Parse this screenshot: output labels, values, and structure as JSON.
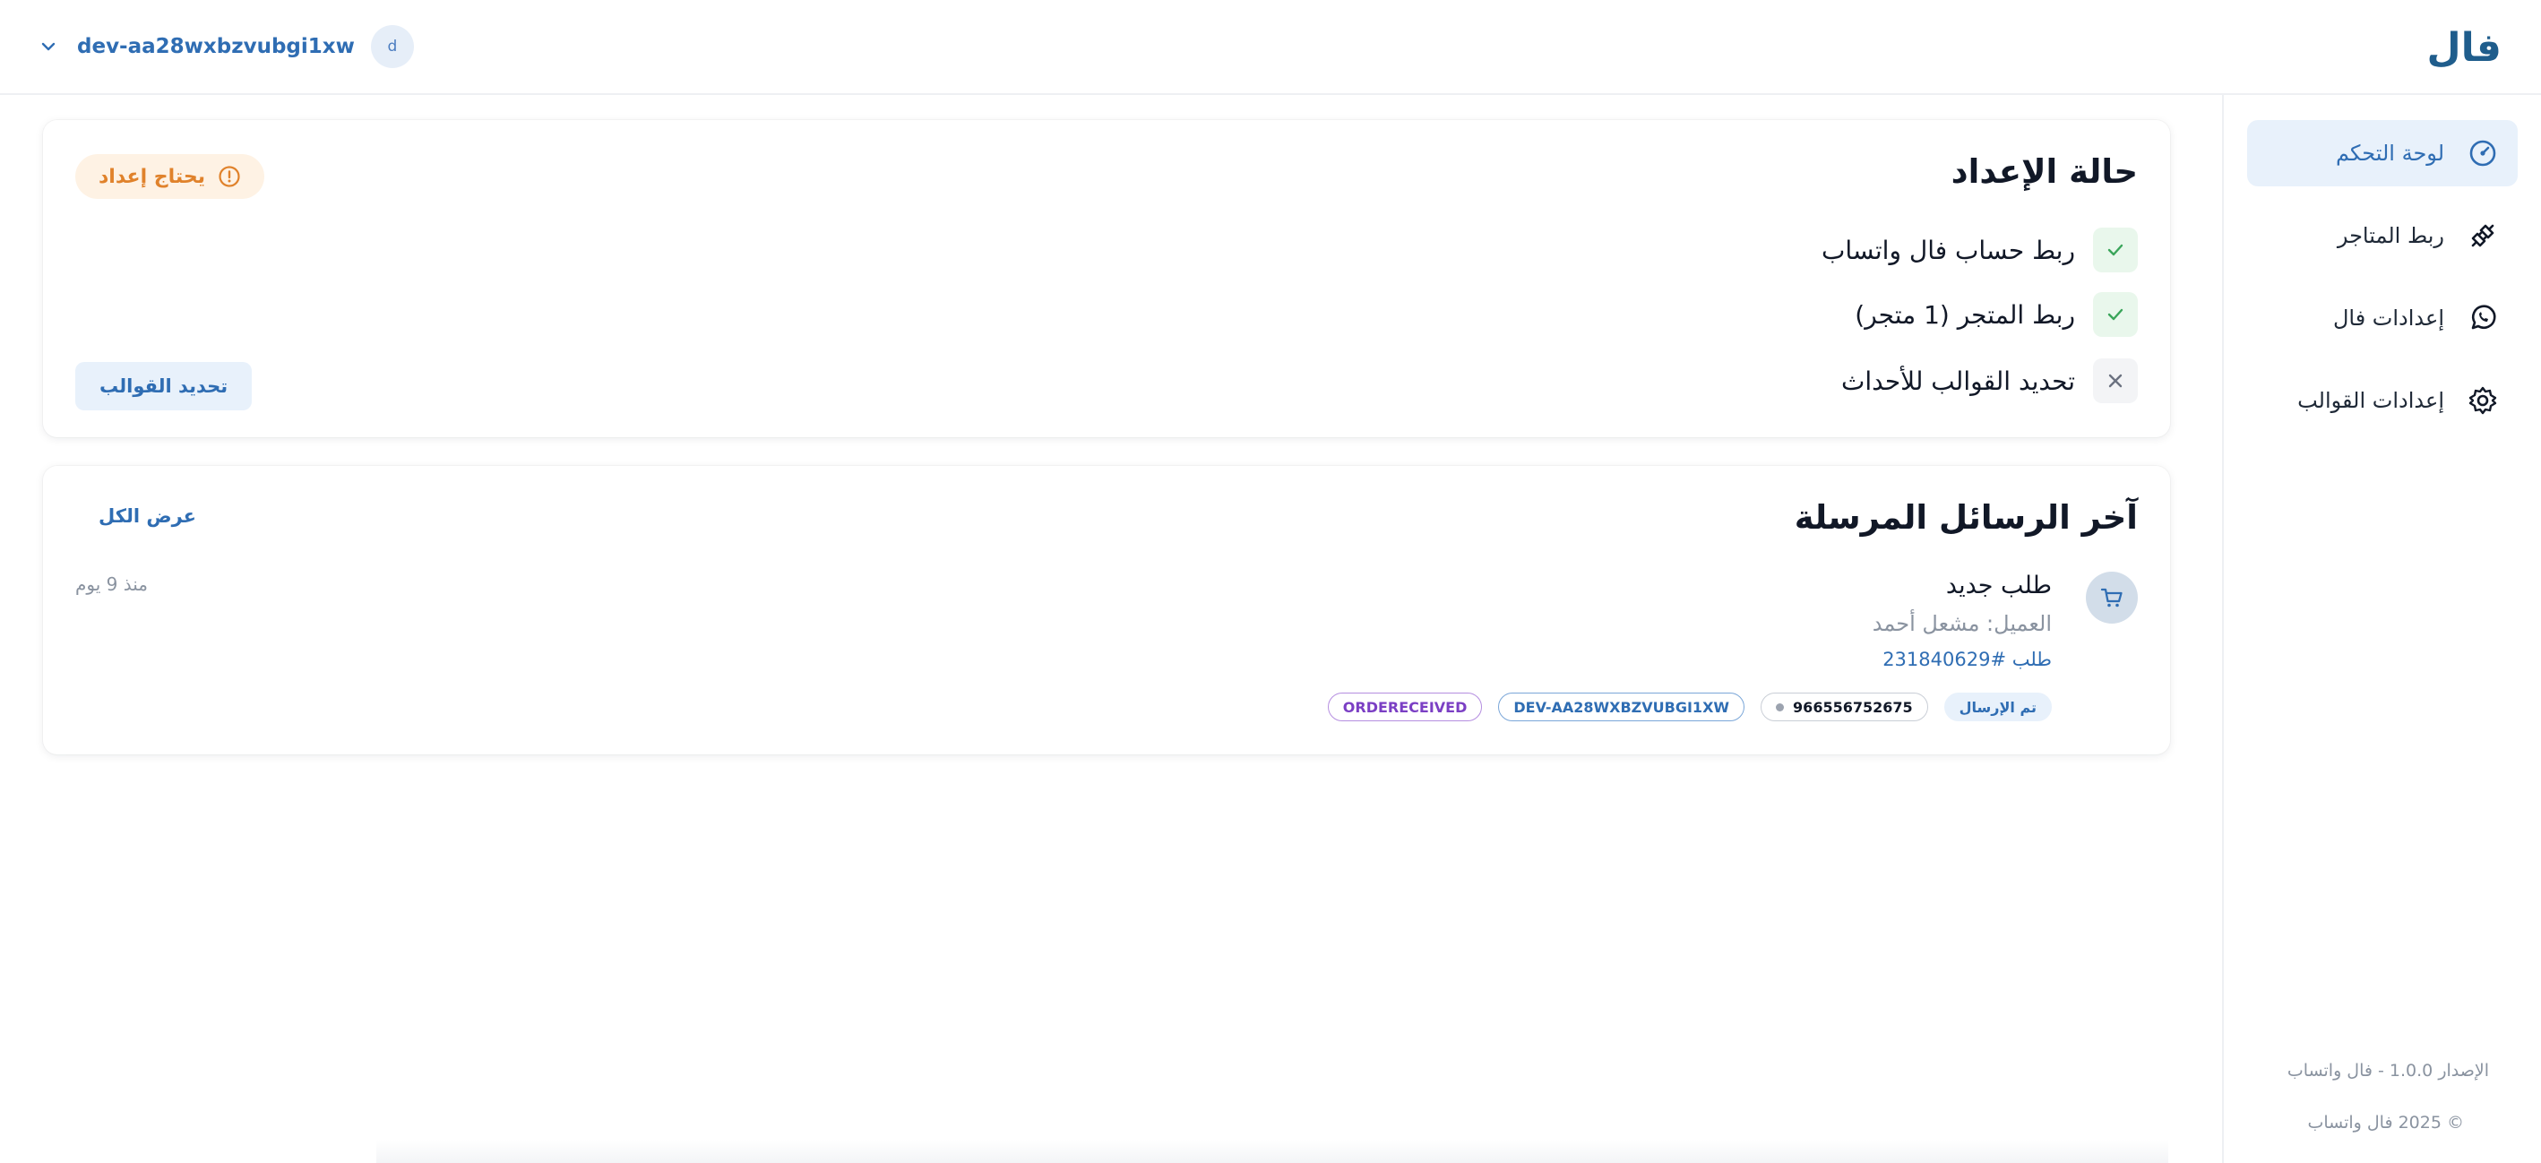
{
  "app": {
    "logo_text": "فال"
  },
  "header": {
    "account_name": "dev-aa28wxbzvubgi1xw",
    "avatar_initial": "d"
  },
  "sidebar": {
    "items": [
      {
        "label": "لوحة التحكم",
        "icon": "dashboard-gauge-icon",
        "active": true
      },
      {
        "label": "ربط المتاجر",
        "icon": "plug-connect-icon",
        "active": false
      },
      {
        "label": "إعدادات فال",
        "icon": "whatsapp-icon",
        "active": false
      },
      {
        "label": "إعدادات القوالب",
        "icon": "gear-icon",
        "active": false
      }
    ],
    "version_text": "الإصدار 1.0.0 - فال واتساب",
    "copyright_text": "© 2025 فال واتساب"
  },
  "setup": {
    "title": "حالة الإعداد",
    "status_badge": "يحتاج إعداد",
    "steps": [
      {
        "label": "ربط حساب فال واتساب",
        "done": true
      },
      {
        "label": "ربط المتجر (1 متجر)",
        "done": true
      },
      {
        "label": "تحديد القوالب للأحداث",
        "done": false
      }
    ],
    "action_button": "تحديد القوالب"
  },
  "messages": {
    "title": "آخر الرسائل المرسلة",
    "view_all": "عرض الكل",
    "items": [
      {
        "title": "طلب جديد",
        "customer": "العميل: مشعل أحمد",
        "order": "طلب #231840629",
        "time": "منذ 9 يوم",
        "status_chip": "تم الإرسال",
        "phone": "966556752675",
        "account_chip": "DEV-AA28WXBZVUBGI1XW",
        "event_chip": "ORDERECEIVED",
        "icon": "cart-icon"
      }
    ]
  },
  "colors": {
    "accent": "#2f6db3",
    "active_nav_bg": "#e8f1fb",
    "warning": "#e0822b",
    "warning_bg": "#fef2e4",
    "success": "#3aa55a",
    "success_bg": "#e9f7ec",
    "event_purple": "#7b3fc4"
  }
}
